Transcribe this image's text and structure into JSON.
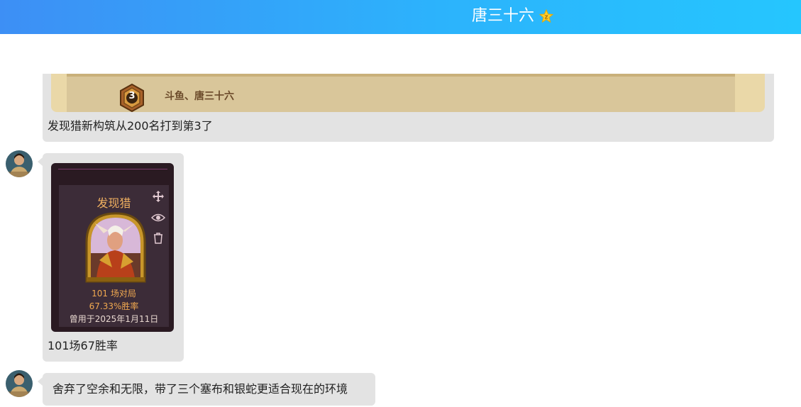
{
  "header": {
    "title": "唐三十六",
    "badge_icon": "star-icon"
  },
  "messages": [
    {
      "type": "rank-share",
      "rank_number": "3",
      "rank_name": "斗鱼、唐三十六",
      "text": "发现猎新构筑从200名打到第3了"
    },
    {
      "type": "deck-share",
      "deck": {
        "name": "发现猎",
        "games": "101 场对局",
        "winrate": "67.33%胜率",
        "used_on": "曾用于2025年1月11日"
      },
      "tools": [
        "move-icon",
        "eye-icon",
        "trash-icon"
      ],
      "text": "101场67胜率"
    },
    {
      "type": "text",
      "text": "舍弃了空余和无限，带了三个塞布和银蛇更适合现在的环境"
    }
  ],
  "colors": {
    "header_start": "#3d8ff5",
    "header_end": "#25c6fe",
    "bubble": "#e3e3e3",
    "deck_gold": "#f0a850"
  }
}
